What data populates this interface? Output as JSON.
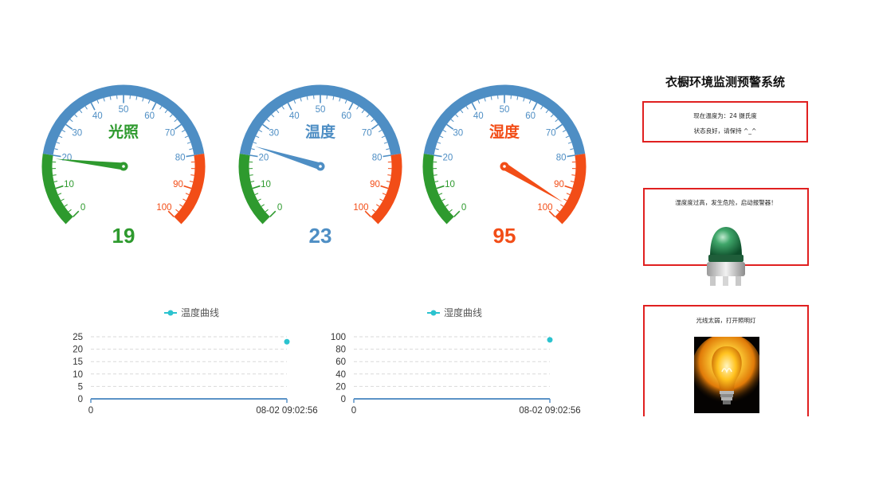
{
  "colors": {
    "green": "#2e9a2e",
    "blue": "#4e8ec4",
    "orange": "#f24d17",
    "alarm_border": "#e02020",
    "series_dot": "#2bc3cf",
    "axis_line": "#5b93c7"
  },
  "gauges": [
    {
      "title": "光照",
      "value": 19,
      "title_color": "#2e9a2e",
      "value_color": "#2e9a2e",
      "needle_color": "#2e9a2e",
      "ticks": [
        "0",
        "10",
        "20",
        "30",
        "40",
        "50",
        "60",
        "70",
        "80",
        "90",
        "100"
      ]
    },
    {
      "title": "温度",
      "value": 23,
      "title_color": "#4e8ec4",
      "value_color": "#4e8ec4",
      "needle_color": "#4e8ec4",
      "ticks": [
        "0",
        "10",
        "20",
        "30",
        "40",
        "50",
        "60",
        "70",
        "80",
        "90",
        "100"
      ]
    },
    {
      "title": "湿度",
      "value": 95,
      "title_color": "#f24d17",
      "value_color": "#f24d17",
      "needle_color": "#f24d17",
      "ticks": [
        "0",
        "10",
        "20",
        "30",
        "40",
        "50",
        "60",
        "70",
        "80",
        "90",
        "100"
      ]
    }
  ],
  "chart_data": [
    {
      "type": "line",
      "legend": "温度曲线",
      "legend_position": "top-center",
      "grid": true,
      "series": [
        {
          "name": "温度曲线",
          "x": [
            "08-02 09:02:56"
          ],
          "values": [
            23
          ]
        }
      ],
      "x_ticks": [
        "0",
        "08-02 09:02:56"
      ],
      "y_ticks": [
        "0",
        "5",
        "10",
        "15",
        "20",
        "25"
      ],
      "ylim": [
        0,
        25
      ]
    },
    {
      "type": "line",
      "legend": "湿度曲线",
      "legend_position": "top-center",
      "grid": true,
      "series": [
        {
          "name": "湿度曲线",
          "x": [
            "08-02 09:02:56"
          ],
          "values": [
            95
          ]
        }
      ],
      "x_ticks": [
        "0",
        "08-02 09:02:56"
      ],
      "y_ticks": [
        "0",
        "20",
        "40",
        "60",
        "80",
        "100"
      ],
      "ylim": [
        0,
        100
      ]
    }
  ],
  "system": {
    "title": "衣橱环境监测预警系统",
    "temp_status_line1": "现在温度为：24 摄氏度",
    "temp_status_line2": "状态良好，请保持 ^_^",
    "humidity_alert": "湿度度过高，发生危险，启动报警器！",
    "light_alert": "光线太弱，打开照明灯",
    "alarm_icon": "alarm-beacon-icon",
    "bulb_icon": "light-bulb-icon"
  }
}
